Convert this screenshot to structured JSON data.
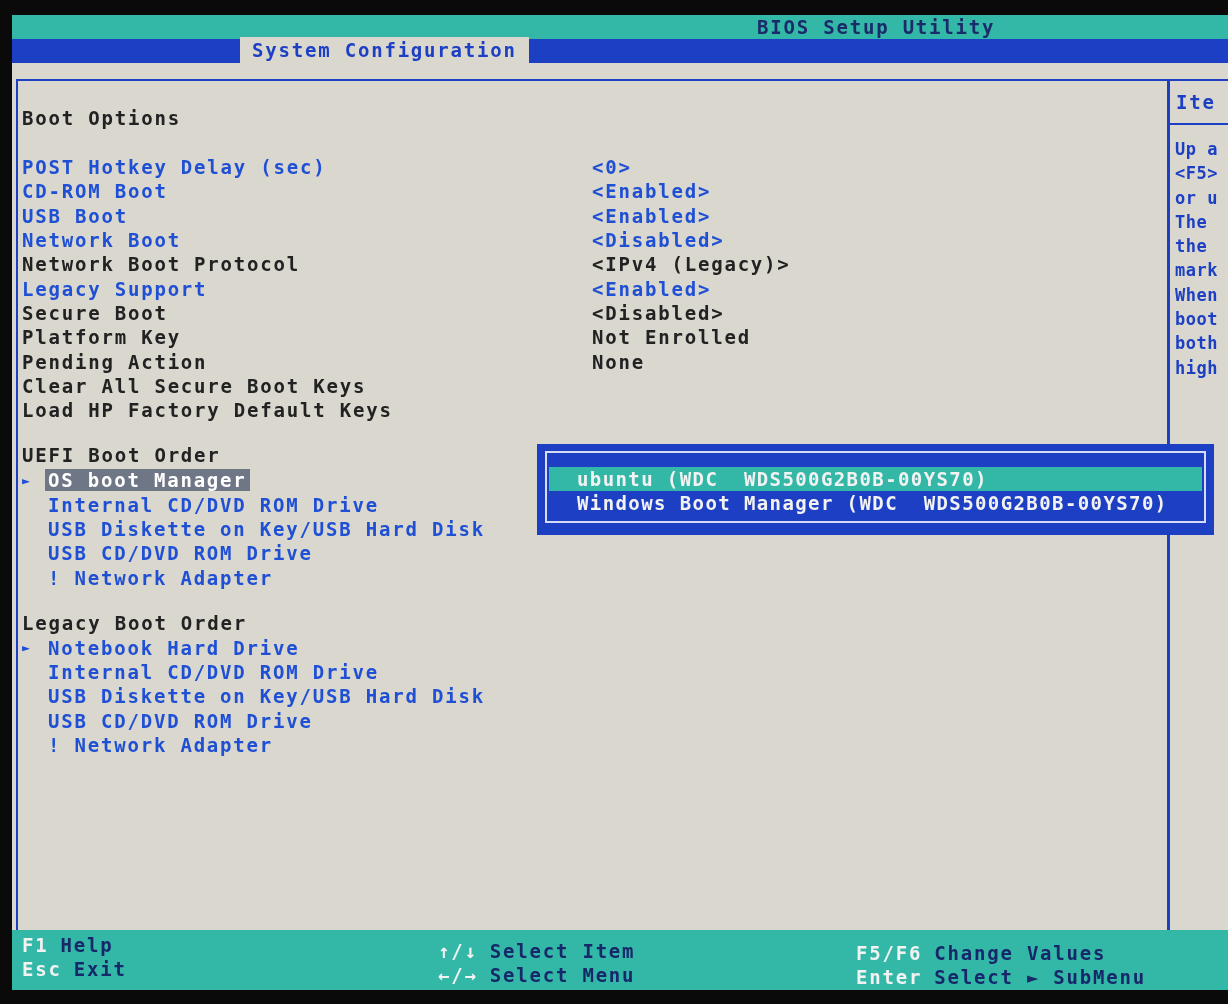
{
  "window": {
    "title": "BIOS Setup Utility"
  },
  "tabs": [
    {
      "label": "System Configuration",
      "selected": true
    }
  ],
  "section_title": "Boot Options",
  "settings": [
    {
      "label": "POST Hotkey Delay (sec)",
      "value": "<0>",
      "editable": true
    },
    {
      "label": "CD-ROM Boot",
      "value": "<Enabled>",
      "editable": true
    },
    {
      "label": "USB Boot",
      "value": "<Enabled>",
      "editable": true
    },
    {
      "label": "Network Boot",
      "value": "<Disabled>",
      "editable": true
    },
    {
      "label": "Network Boot Protocol",
      "value": "<IPv4 (Legacy)>",
      "editable": false
    },
    {
      "label": "Legacy Support",
      "value": "<Enabled>",
      "editable": true
    },
    {
      "label": "Secure Boot",
      "value": "<Disabled>",
      "editable": false
    },
    {
      "label": "Platform Key",
      "value": "Not Enrolled",
      "editable": false
    },
    {
      "label": "Pending Action",
      "value": "None",
      "editable": false
    },
    {
      "label": "Clear All Secure Boot Keys",
      "editable": false
    },
    {
      "label": "Load HP Factory Default Keys",
      "editable": false
    }
  ],
  "boot_orders": [
    {
      "title": "UEFI Boot Order",
      "items": [
        {
          "pointer": "►",
          "label": "OS boot Manager",
          "selected": true
        },
        {
          "label": "Internal CD/DVD ROM Drive",
          "selected": false
        },
        {
          "label": "USB Diskette on Key/USB Hard Disk",
          "selected": false
        },
        {
          "label": "USB CD/DVD ROM Drive",
          "selected": false
        },
        {
          "label": "! Network Adapter",
          "selected": false
        }
      ]
    },
    {
      "title": "Legacy Boot Order",
      "items": [
        {
          "pointer": "►",
          "label": "Notebook Hard Drive",
          "selected": false
        },
        {
          "label": "Internal CD/DVD ROM Drive",
          "selected": false
        },
        {
          "label": "USB Diskette on Key/USB Hard Disk",
          "selected": false
        },
        {
          "label": "USB CD/DVD ROM Drive",
          "selected": false
        },
        {
          "label": "! Network Adapter",
          "selected": false
        }
      ]
    }
  ],
  "popup": {
    "options": [
      {
        "label": "ubuntu (WDC  WDS500G2B0B-00YS70)",
        "selected": true
      },
      {
        "label": "Windows Boot Manager (WDC  WDS500G2B0B-00YS70)",
        "selected": false
      }
    ]
  },
  "help_panel": {
    "title": "Ite",
    "lines": [
      "Up a",
      "<F5>",
      "or u",
      "The",
      "the",
      "mark",
      "When",
      "boot",
      "both",
      "high"
    ]
  },
  "status_bar": [
    [
      {
        "key": "F1",
        "action": "Help"
      },
      {
        "key": "Esc",
        "action": "Exit"
      }
    ],
    [
      {
        "key": "↑/↓",
        "action": "Select Item"
      },
      {
        "key": "←/→",
        "action": "Select Menu"
      }
    ],
    [
      {
        "key": "F5/F6",
        "action": "Change Values"
      },
      {
        "key": "Enter",
        "action": "Select ► SubMenu"
      }
    ]
  ]
}
